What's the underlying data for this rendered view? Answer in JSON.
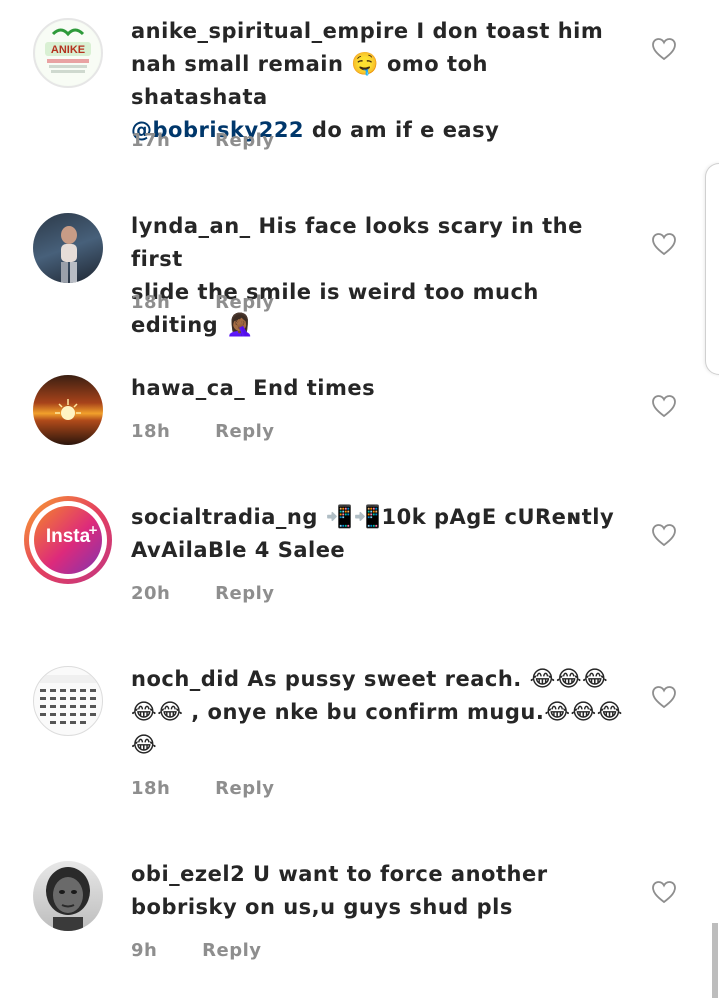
{
  "comments": [
    {
      "username": "anike_spiritual_empire",
      "text_line1": "I don toast him",
      "text_line2a": "nah small remain",
      "emoji1": "🤤",
      "text_line2b": "omo toh shatashata",
      "mention": "@bobrisky222",
      "text_line3": "do am if e easy",
      "time": "17h",
      "reply": "Reply",
      "avatar_text": "ANIKE"
    },
    {
      "username": "lynda_an_",
      "text_line1": "His face looks scary in the first",
      "text_line2": "slide the smile is weird too much editing",
      "emoji1": "🤦🏾‍♀️",
      "time": "18h",
      "reply": "Reply"
    },
    {
      "username": "hawa_ca_",
      "text_line1": "End times",
      "time": "18h",
      "reply": "Reply"
    },
    {
      "username": "socialtradia_ng",
      "emoji1": "📲📲",
      "text_line1": "10k pAgE cUReɴtly",
      "text_line2": "AvAilaBle 4 Salee",
      "time": "20h",
      "reply": "Reply",
      "avatar_text": "Insta"
    },
    {
      "username": "noch_did",
      "text_line1": "As pussy sweet reach.",
      "emoji_row1": "😂😂😂",
      "emoji_row2": "😂😂",
      "text_line2": ", onye nke bu confirm mugu.",
      "emoji_row2b": "😂😂😂",
      "emoji_row3": "😂",
      "time": "18h",
      "reply": "Reply",
      "avatar_text": "IGBO ALPHABET"
    },
    {
      "username": "obi_ezel2",
      "text_line1": "U want to force another",
      "text_line2": "bobrisky on us,u guys shud pls",
      "time": "9h",
      "reply": "Reply"
    }
  ],
  "icons": {
    "like": "heart-outline-icon"
  },
  "colors": {
    "text": "#262626",
    "meta": "#8e8e8e",
    "mention": "#00376b"
  }
}
